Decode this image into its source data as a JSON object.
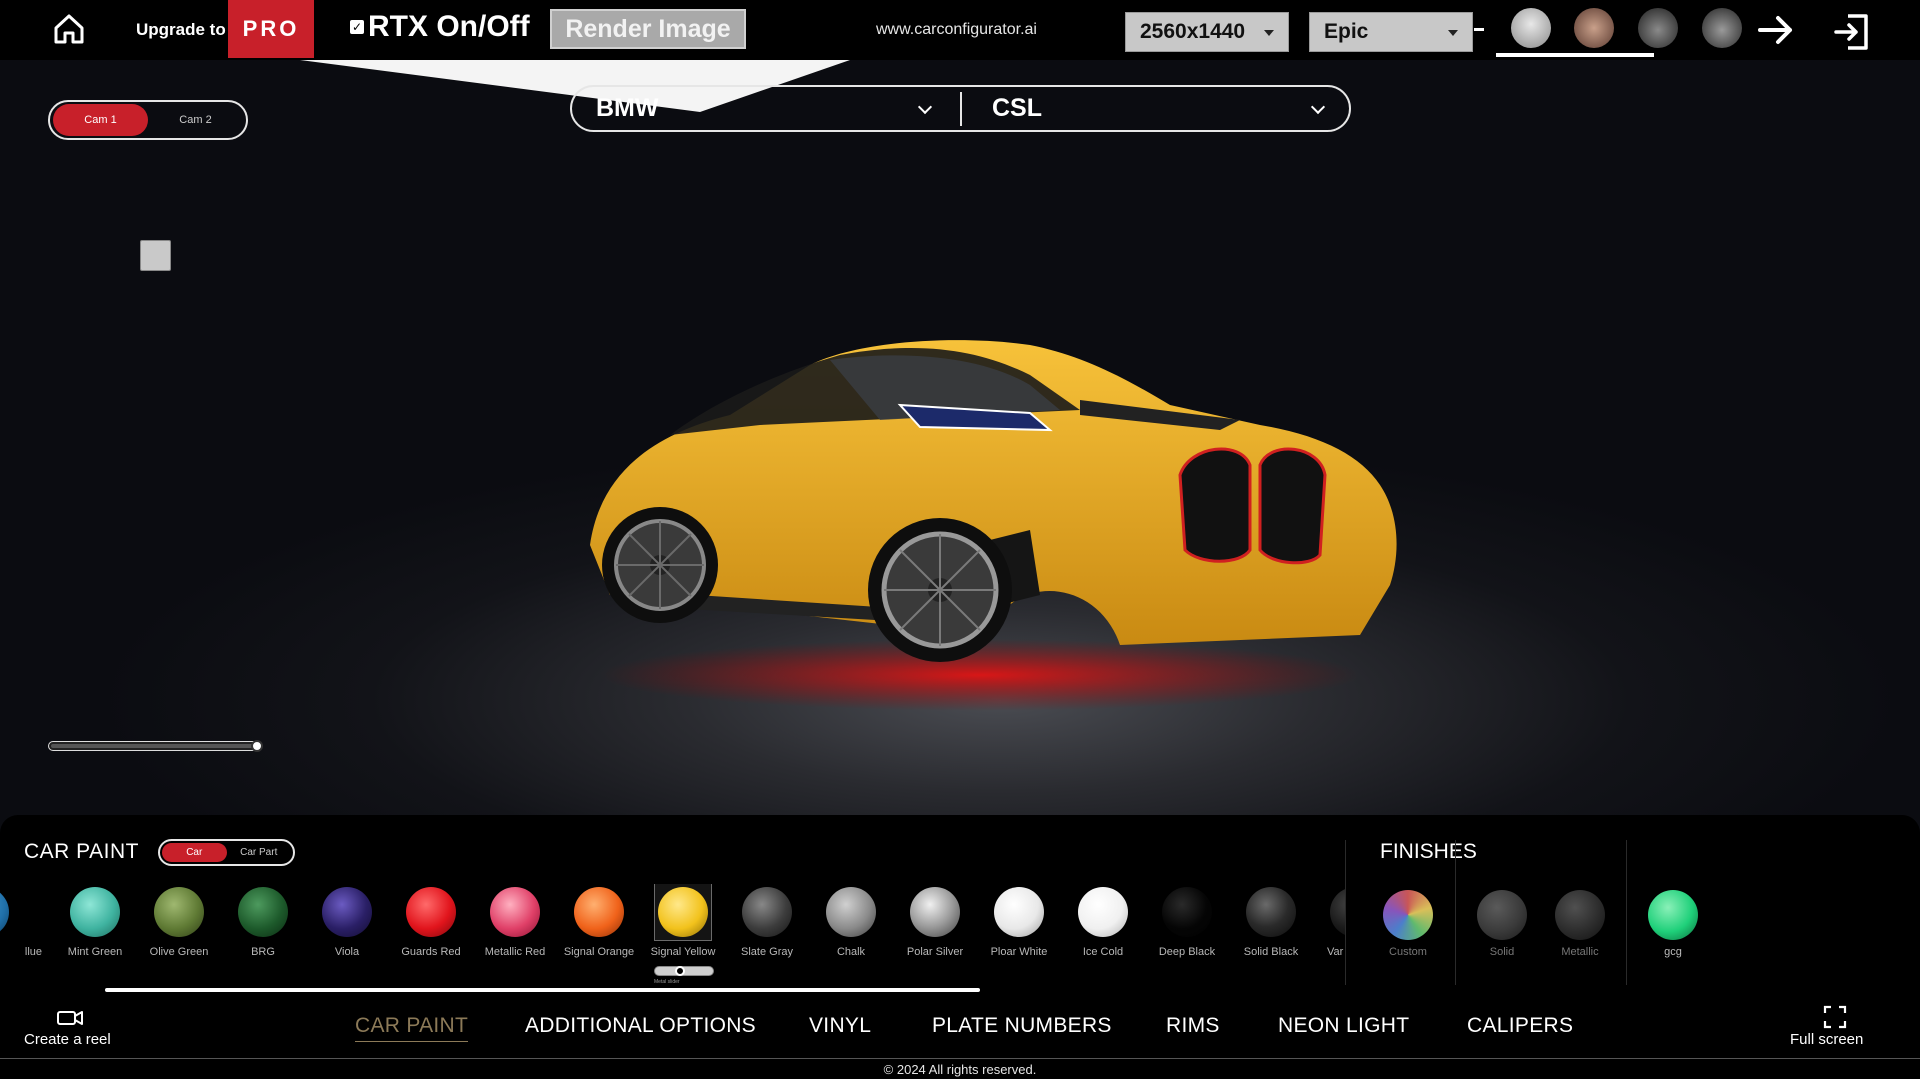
{
  "topbar": {
    "upgrade_text": "Upgrade to",
    "pro_label": "PRO",
    "rtx_label": "RTX On/Off",
    "rtx_checked": true,
    "render_label": "Render Image",
    "site_url": "www.carconfigurator.ai",
    "resolution": "2560x1440",
    "quality": "Epic",
    "icons": [
      "home-icon",
      "arrow-right-icon",
      "exit-icon"
    ]
  },
  "camera": {
    "options": [
      "Cam 1",
      "Cam 2"
    ],
    "active": "Cam 1"
  },
  "vehicle": {
    "make": "BMW",
    "model": "CSL"
  },
  "paint": {
    "title": "CAR PAINT",
    "target_options": [
      "Car",
      "Car Part"
    ],
    "target_active": "Car",
    "swatches": [
      {
        "name": "Blue",
        "visible_name": "llue",
        "color": "#1f6fa8"
      },
      {
        "name": "Mint Green",
        "color": "#3fb3a0"
      },
      {
        "name": "Olive Green",
        "color": "#5f7a34"
      },
      {
        "name": "BRG",
        "color": "#1d5a2b"
      },
      {
        "name": "Viola",
        "color": "#2a1f66"
      },
      {
        "name": "Guards Red",
        "color": "#e1141c"
      },
      {
        "name": "Metallic Red",
        "color": "#e04068"
      },
      {
        "name": "Signal Orange",
        "color": "#f0621a"
      },
      {
        "name": "Signal Yellow",
        "color": "#f2c21c"
      },
      {
        "name": "Slate Gray",
        "color": "#3c3c3c"
      },
      {
        "name": "Chalk",
        "color": "#8a8a8a"
      },
      {
        "name": "Polar Silver",
        "color": "#9c9c9c"
      },
      {
        "name": "Ploar White",
        "color": "#e8e8e8"
      },
      {
        "name": "Ice Cold",
        "color": "#f0f0f0"
      },
      {
        "name": "Deep Black",
        "color": "#050505"
      },
      {
        "name": "Solid Black",
        "color": "#2a2a2a"
      },
      {
        "name": "Var",
        "color": "#1a1a1a"
      }
    ],
    "selected": "Signal Yellow",
    "metal_slider_label": "Metal slider",
    "metal_slider_value": 0.33
  },
  "finishes": {
    "title": "FINISHES",
    "items": [
      {
        "name": "Custom",
        "color": "conic"
      },
      {
        "name": "Solid",
        "color": "#3a3a3a"
      },
      {
        "name": "Metallic",
        "color": "#2c2c2c"
      },
      {
        "name": "gcg",
        "color": "#1fd07a"
      }
    ]
  },
  "tabs": {
    "items": [
      "CAR PAINT",
      "ADDITIONAL OPTIONS",
      "VINYL",
      "PLATE NUMBERS",
      "RIMS",
      "NEON LIGHT",
      "CALIPERS"
    ],
    "active": "CAR PAINT"
  },
  "actions": {
    "reel_label": "Create a reel",
    "fullscreen_label": "Full screen"
  },
  "footer": {
    "copyright": "© 2024 All rights reserved."
  },
  "colors": {
    "accent_red": "#c8202a",
    "active_tab": "#8c7a58",
    "car_body": "#f0b020",
    "underglow": "#d01010"
  }
}
